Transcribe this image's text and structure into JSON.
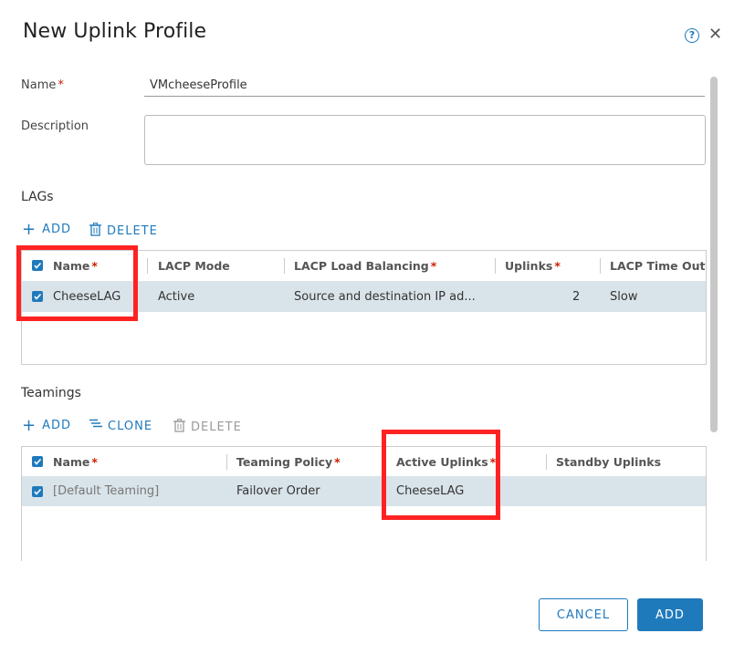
{
  "dialog": {
    "title": "New Uplink Profile"
  },
  "form": {
    "name_label": "Name",
    "name_value": "VMcheeseProfile",
    "description_label": "Description",
    "required_mark": "*"
  },
  "lags": {
    "title": "LAGs",
    "add_label": "ADD",
    "delete_label": "DELETE",
    "columns": [
      "Name",
      "LACP Mode",
      "LACP Load Balancing",
      "Uplinks",
      "LACP Time Out"
    ],
    "rows": [
      {
        "name": "CheeseLAG",
        "mode": "Active",
        "load_balancing": "Source and destination IP ad...",
        "uplinks": "2",
        "timeout": "Slow"
      }
    ]
  },
  "teamings": {
    "title": "Teamings",
    "add_label": "ADD",
    "clone_label": "CLONE",
    "delete_label": "DELETE",
    "columns": [
      "Name",
      "Teaming Policy",
      "Active Uplinks",
      "Standby Uplinks"
    ],
    "rows": [
      {
        "name": "[Default Teaming]",
        "policy": "Failover Order",
        "active": "CheeseLAG",
        "standby": ""
      }
    ]
  },
  "footer": {
    "cancel_label": "CANCEL",
    "add_label": "ADD"
  },
  "colors": {
    "accent": "#1f7abc",
    "highlight": "#ff2222",
    "selected_row": "#d9e4ea",
    "required": "#c92100"
  }
}
